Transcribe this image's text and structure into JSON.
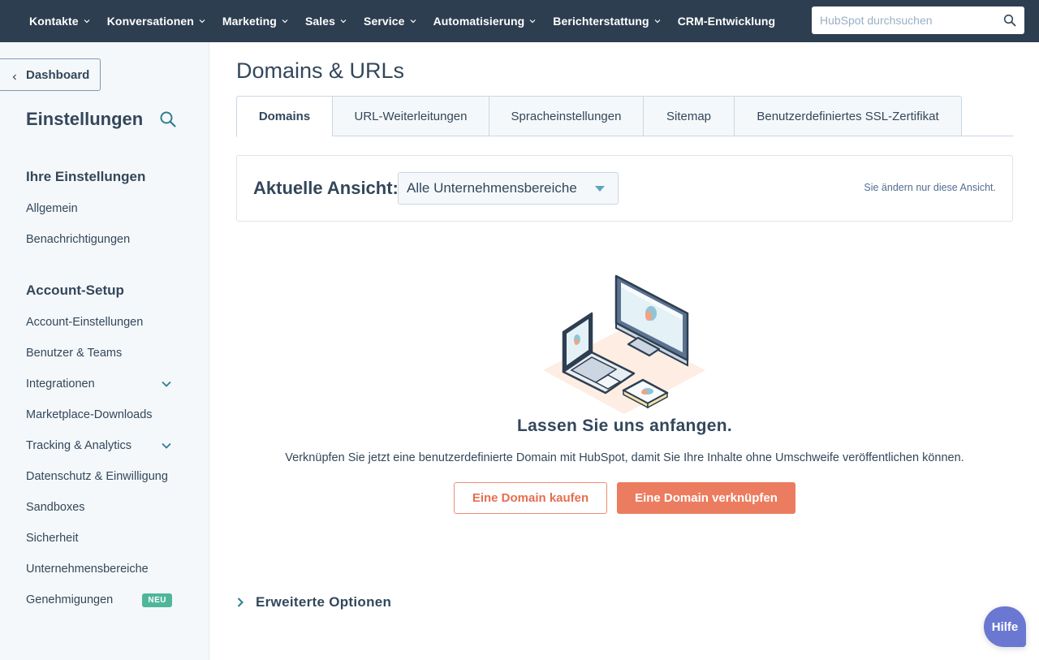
{
  "topnav": {
    "items": [
      {
        "label": "Kontakte",
        "has_dropdown": true
      },
      {
        "label": "Konversationen",
        "has_dropdown": true
      },
      {
        "label": "Marketing",
        "has_dropdown": true
      },
      {
        "label": "Sales",
        "has_dropdown": true
      },
      {
        "label": "Service",
        "has_dropdown": true
      },
      {
        "label": "Automatisierung",
        "has_dropdown": true
      },
      {
        "label": "Berichterstattung",
        "has_dropdown": true
      },
      {
        "label": "CRM-Entwicklung",
        "has_dropdown": false
      }
    ],
    "search": {
      "placeholder": "HubSpot durchsuchen",
      "value": "",
      "icon": "search-icon"
    }
  },
  "sidebar": {
    "back_label": "Dashboard",
    "title": "Einstellungen",
    "sections": [
      {
        "heading": "Ihre Einstellungen",
        "items": [
          {
            "label": "Allgemein"
          },
          {
            "label": "Benachrichtigungen"
          }
        ]
      },
      {
        "heading": "Account-Setup",
        "items": [
          {
            "label": "Account-Einstellungen"
          },
          {
            "label": "Benutzer & Teams"
          },
          {
            "label": "Integrationen",
            "expandable": true
          },
          {
            "label": "Marketplace-Downloads"
          },
          {
            "label": "Tracking & Analytics",
            "expandable": true
          },
          {
            "label": "Datenschutz & Einwilligung"
          },
          {
            "label": "Sandboxes"
          },
          {
            "label": "Sicherheit"
          },
          {
            "label": "Unternehmensbereiche"
          },
          {
            "label": "Genehmigungen",
            "badge": "NEU"
          }
        ]
      }
    ]
  },
  "main": {
    "title": "Domains & URLs",
    "tabs": [
      {
        "label": "Domains",
        "active": true
      },
      {
        "label": "URL-Weiterleitungen",
        "active": false
      },
      {
        "label": "Spracheinstellungen",
        "active": false
      },
      {
        "label": "Sitemap",
        "active": false
      },
      {
        "label": "Benutzerdefiniertes SSL-Zertifikat",
        "active": false
      }
    ],
    "view": {
      "label": "Aktuelle Ansicht:",
      "selected": "Alle Unternehmensbereiche",
      "note": "Sie ändern nur diese Ansicht."
    },
    "empty_state": {
      "illustration": "devices-illustration",
      "title": "Lassen Sie uns anfangen.",
      "description": "Verknüpfen Sie jetzt eine benutzerdefinierte Domain mit HubSpot, damit Sie Ihre Inhalte ohne Umschweife veröffentlichen können.",
      "buy_button": "Eine Domain kaufen",
      "connect_button": "Eine Domain verknüpfen"
    },
    "advanced_options": "Erweiterte Optionen"
  },
  "help_button": "Hilfe",
  "colors": {
    "nav_bg": "#2d3e50",
    "primary_orange": "#ec7c5f",
    "badge_green": "#4fb69a",
    "help_purple": "#6a78d1",
    "accent_teal": "#0091ae"
  }
}
